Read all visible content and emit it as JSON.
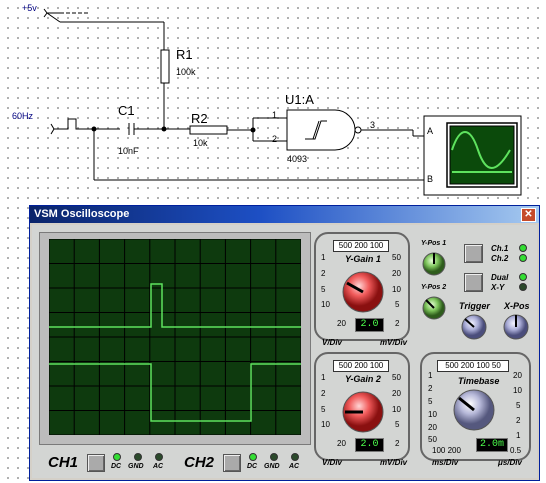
{
  "schematic": {
    "supply_label": "+5v",
    "generator_label": "60Hz",
    "c1_ref": "C1",
    "c1_value": "10nF",
    "r1_ref": "R1",
    "r1_value": "100k",
    "r2_ref": "R2",
    "r2_value": "10k",
    "gate_ref": "U1:A",
    "gate_part": "4093",
    "pin1": "1",
    "pin2": "2",
    "pin3": "3",
    "scope_in_a": "A",
    "scope_in_b": "B"
  },
  "oscilloscope": {
    "title": "VSM Oscilloscope",
    "close_glyph": "✕",
    "channels": {
      "ch1_label": "CH1",
      "ch2_label": "CH2",
      "dc": "DC",
      "gnd": "GND",
      "ac": "AC"
    },
    "ygain1": {
      "title": "Y-Gain 1",
      "scale_top": "500 200 100",
      "left_ticks": [
        "1",
        "2",
        "5",
        "10",
        "20"
      ],
      "right_ticks": [
        "50",
        "20",
        "10",
        "5",
        "2"
      ],
      "display": "2.0",
      "unit_left": "V/Div",
      "unit_right": "mV/Div"
    },
    "ygain2": {
      "title": "Y-Gain 2",
      "scale_top": "500 200 100",
      "left_ticks": [
        "1",
        "2",
        "5",
        "10",
        "20"
      ],
      "right_ticks": [
        "50",
        "20",
        "10",
        "5",
        "2"
      ],
      "display": "2.0",
      "unit_left": "V/Div",
      "unit_right": "mV/Div"
    },
    "timebase": {
      "title": "Timebase",
      "scale_top": "500 200 100 50",
      "left_ticks": [
        "1",
        "2",
        "5",
        "10",
        "20",
        "50",
        "100 200"
      ],
      "right_ticks": [
        "20",
        "10",
        "5",
        "2",
        "1",
        "0.5"
      ],
      "display": "2.0m",
      "unit_left": "ms/Div",
      "unit_right": "μs/Div"
    },
    "ypos1_label": "Y-Pos 1",
    "ypos2_label": "Y-Pos 2",
    "trigger_label": "Trigger",
    "xpos_label": "X-Pos",
    "mode": {
      "ch1": "Ch.1",
      "ch2": "Ch.2",
      "dual": "Dual",
      "xy": "X-Y"
    },
    "colors": {
      "screen_bg": "#0e3a0e",
      "grid": "#000000",
      "trace": "#5ee25e",
      "led_on": "#33dd33"
    }
  }
}
